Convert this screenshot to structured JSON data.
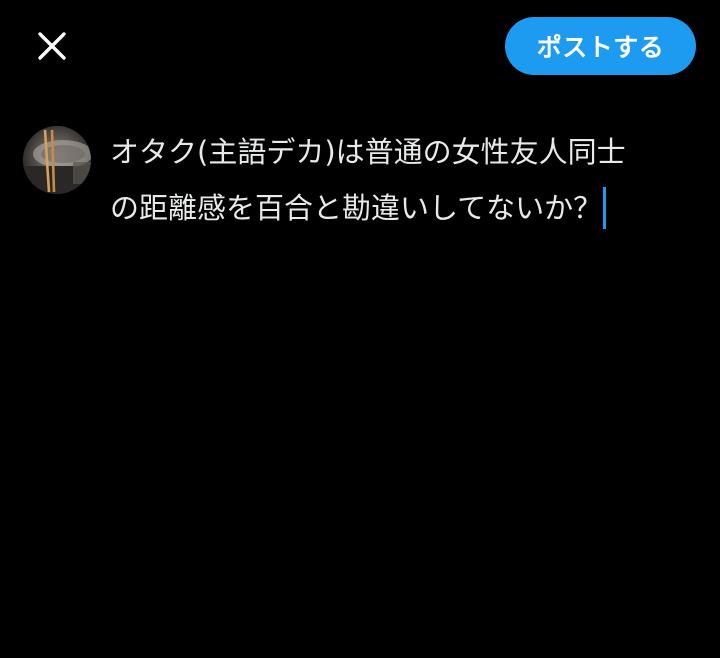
{
  "header": {
    "post_label": "ポストする"
  },
  "compose": {
    "line1": "オタク(主語デカ)は普通の女性友人同士",
    "line2": "の距離感を百合と勘違いしてないか？"
  },
  "icons": {
    "close": "close-icon",
    "avatar": "user-avatar"
  },
  "colors": {
    "accent": "#1d9bf0",
    "background": "#000000",
    "text": "#e7e9ea"
  }
}
